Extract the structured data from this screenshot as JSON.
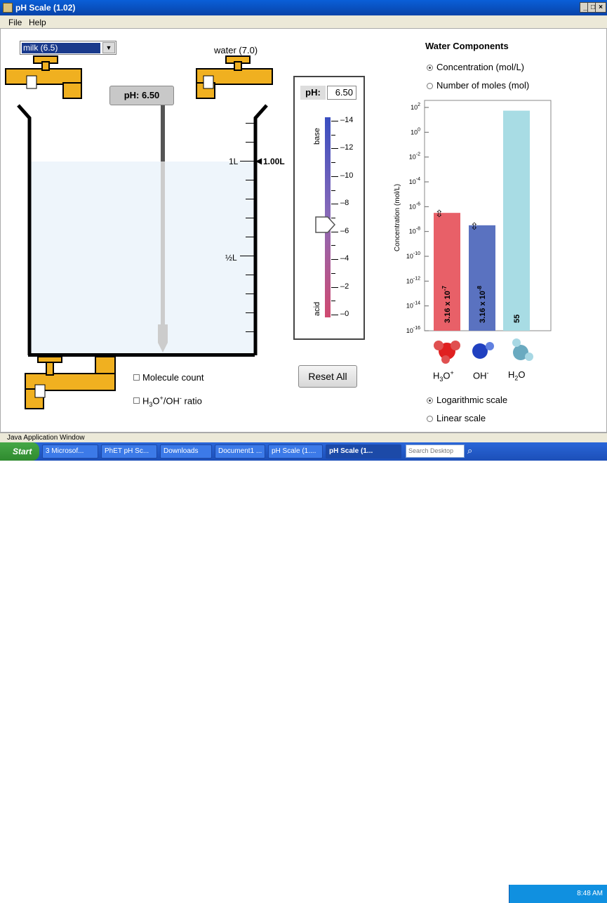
{
  "window": {
    "title": "pH Scale (1.02)",
    "min": "_",
    "max": "□",
    "close": "×"
  },
  "menu": {
    "file": "File",
    "help": "Help"
  },
  "solute_dropdown": {
    "selected": "milk (6.5)"
  },
  "water_faucet": {
    "label": "water (7.0)"
  },
  "probe": {
    "reading": "pH: 6.50"
  },
  "beaker": {
    "volume_readout": "1.00L",
    "mark_1l": "1L",
    "mark_half": "½L"
  },
  "ph_meter": {
    "label": "pH:",
    "value": "6.50",
    "base_label": "base",
    "acid_label": "acid",
    "ticks": [
      "14",
      "12",
      "10",
      "8",
      "6",
      "4",
      "2",
      "0"
    ],
    "ph_level": 6.5
  },
  "checkboxes": {
    "molecule_count": "Molecule count",
    "ratio_prefix": "H",
    "ratio_sub": "3",
    "ratio_mid": "O",
    "ratio_sup": "+",
    "ratio_rest": "/OH",
    "ratio_sup2": "-",
    "ratio_suffix": " ratio"
  },
  "reset_button": "Reset All",
  "water_components": {
    "title": "Water Components",
    "mode_concentration": "Concentration (mol/L)",
    "mode_moles": "Number of moles (mol)",
    "scale_log": "Logarithmic scale",
    "scale_linear": "Linear scale",
    "molecule_h3o": {
      "base": "H",
      "sub": "3",
      "mid": "O",
      "sup": "+"
    },
    "molecule_oh": {
      "base": "OH",
      "sup": "-"
    },
    "molecule_h2o": {
      "base": "H",
      "sub": "2",
      "mid": "O"
    }
  },
  "chart_data": {
    "type": "bar",
    "ylabel": "Concentration (mol/L)",
    "yscale": "log",
    "ylim": [
      1e-16,
      100
    ],
    "ytick_exponents": [
      "2",
      "0",
      "-2",
      "-4",
      "-6",
      "-8",
      "-10",
      "-12",
      "-14",
      "-16"
    ],
    "categories": [
      "H3O+",
      "OH-",
      "H2O"
    ],
    "values": [
      3.16e-07,
      3.16e-08,
      55
    ],
    "value_labels": [
      "3.16 x 10",
      "3.16 x 10",
      "55"
    ],
    "value_exponents": [
      "-7",
      "-8",
      ""
    ],
    "colors": [
      "#e86068",
      "#5a72c0",
      "#a8dce4"
    ]
  },
  "status_bar": "Java Application Window",
  "taskbar": {
    "start": "Start",
    "items": [
      "3 Microsof...",
      "PhET pH Sc...",
      "Downloads",
      "Document1 ...",
      "pH Scale (1....",
      "pH Scale (1..."
    ],
    "search_placeholder": "Search Desktop",
    "clock": "8:48 AM"
  }
}
